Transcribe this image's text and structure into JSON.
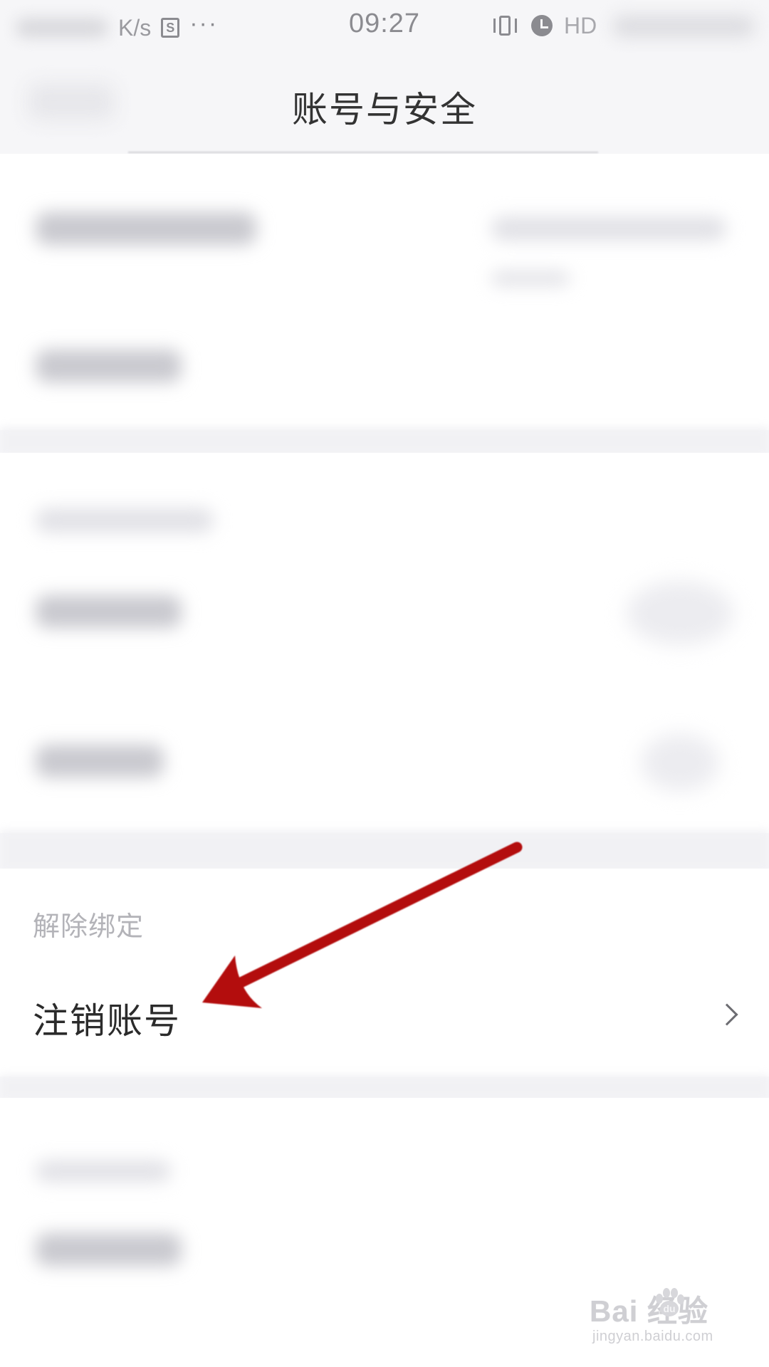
{
  "status_bar": {
    "speed": "K/s",
    "sim_icon": "S",
    "more_dots": "···",
    "time": "09:27",
    "icons": [
      "vibrate-icon",
      "alarm-icon"
    ],
    "hd": "HD"
  },
  "nav": {
    "title": "账号与安全"
  },
  "unbind_section": {
    "header": "解除绑定",
    "cancel_account_label": "注销账号"
  },
  "annotation": {
    "color": "#b50d0d",
    "icon": "arrow-icon"
  },
  "watermark": {
    "logo": "Bai  经验",
    "url": "jingyan.baidu.com"
  }
}
